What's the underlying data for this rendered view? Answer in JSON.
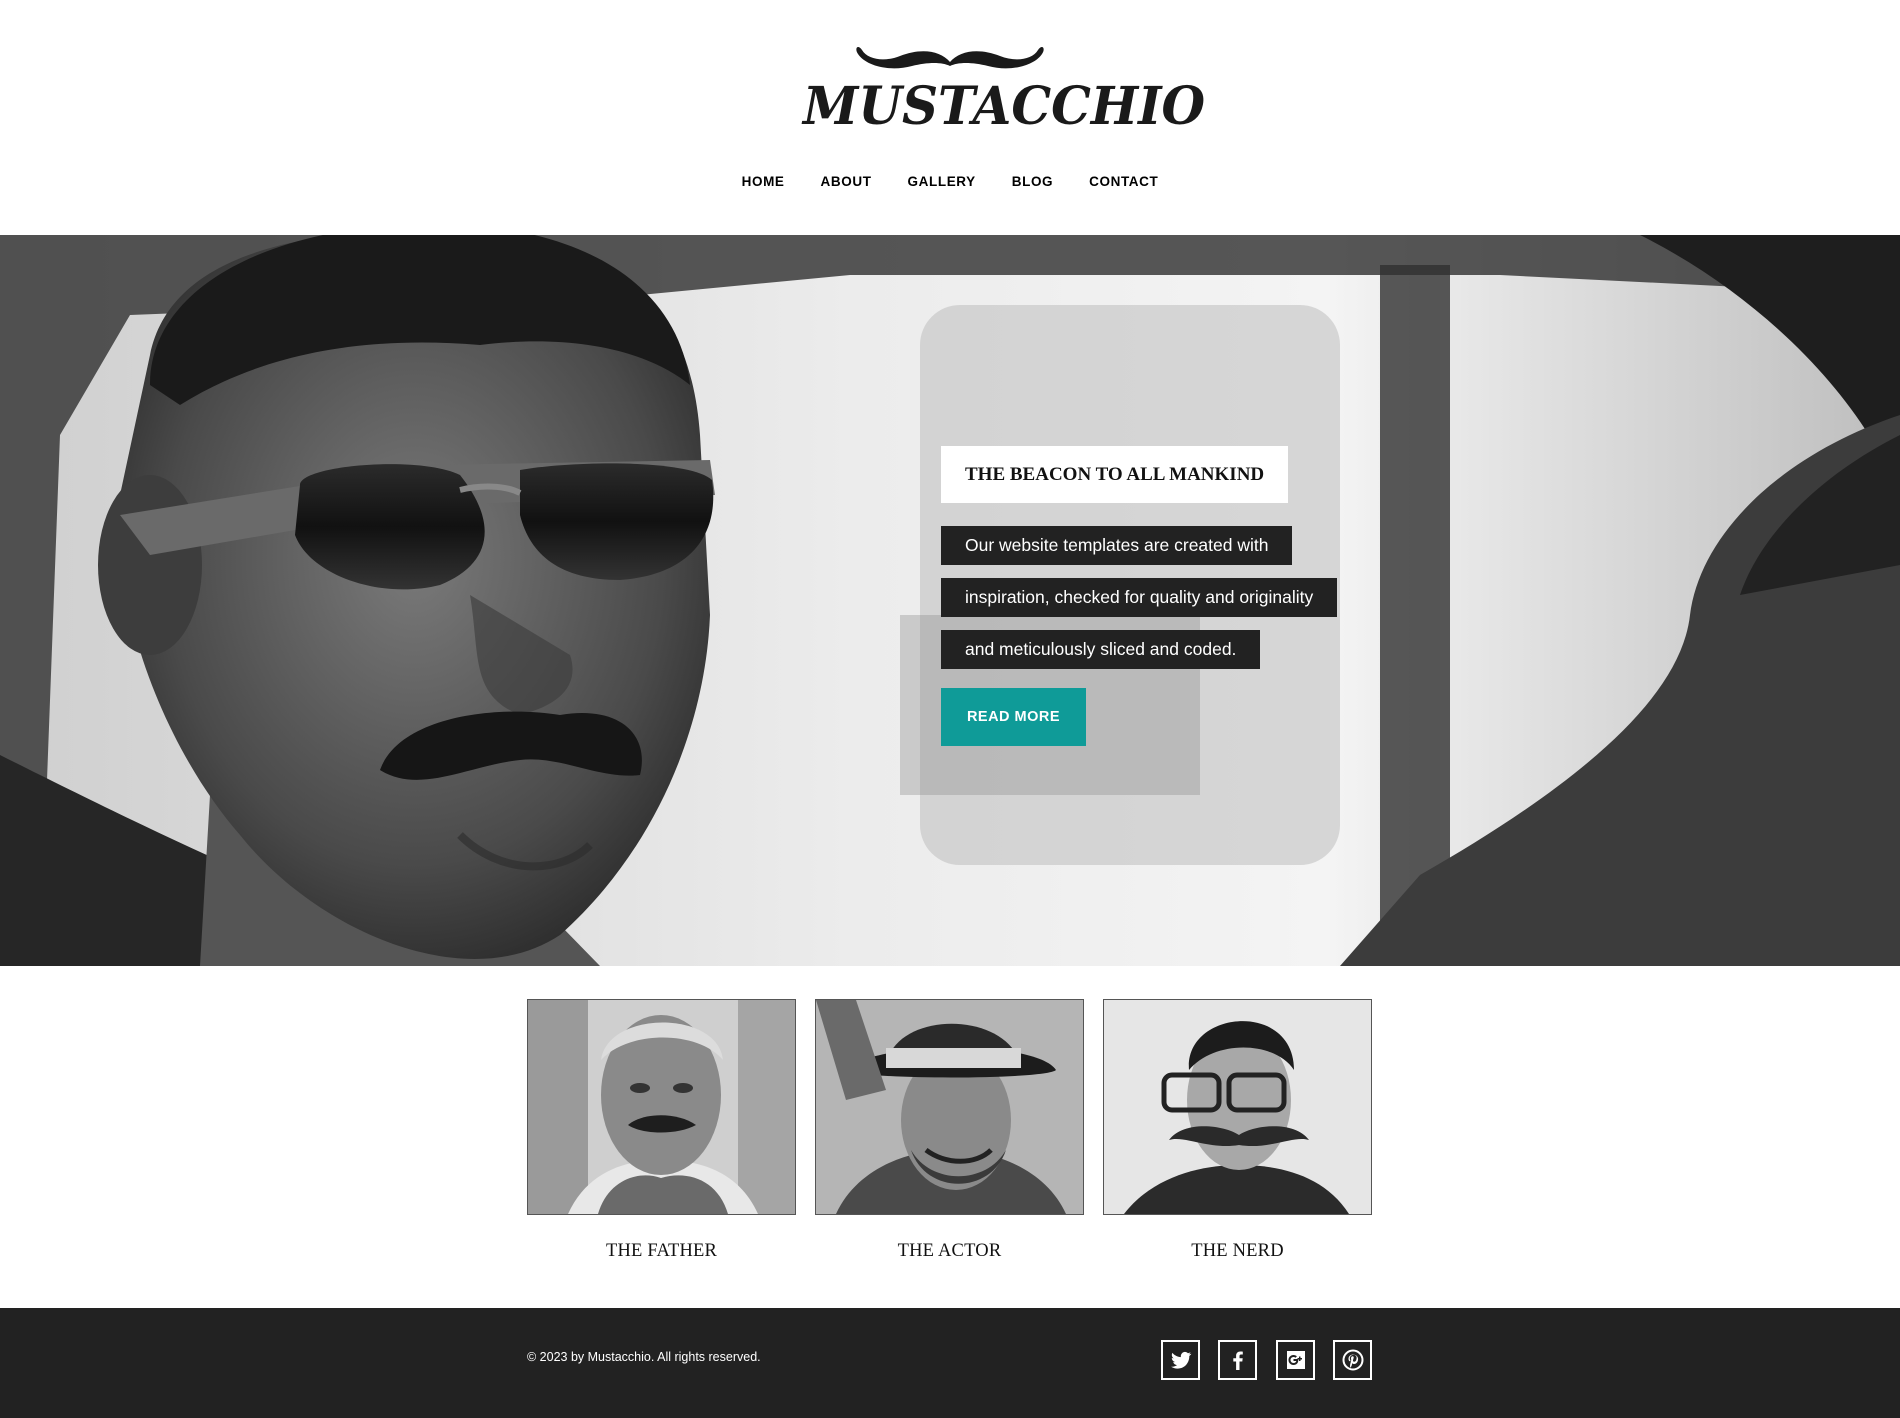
{
  "brand": {
    "logo_text": "MUSTACCHIO",
    "logo_icon": "mustache-icon"
  },
  "nav": {
    "items": [
      {
        "label": "HOME"
      },
      {
        "label": "ABOUT"
      },
      {
        "label": "GALLERY"
      },
      {
        "label": "BLOG"
      },
      {
        "label": "CONTACT"
      }
    ]
  },
  "hero": {
    "title": "THE BEACON TO ALL MANKIND",
    "lines": [
      "Our website templates are created with",
      "inspiration, checked for quality and originality",
      "and meticulously sliced and coded."
    ],
    "button_label": "READ MORE",
    "accent_color": "#0f9b98"
  },
  "cards": [
    {
      "caption": "THE FATHER"
    },
    {
      "caption": "THE ACTOR"
    },
    {
      "caption": "THE NERD"
    }
  ],
  "footer": {
    "copyright": "© 2023 by Mustacchio. All rights reserved.",
    "social": [
      {
        "icon": "twitter-icon"
      },
      {
        "icon": "facebook-icon"
      },
      {
        "icon": "google-plus-icon"
      },
      {
        "icon": "pinterest-icon"
      }
    ]
  }
}
